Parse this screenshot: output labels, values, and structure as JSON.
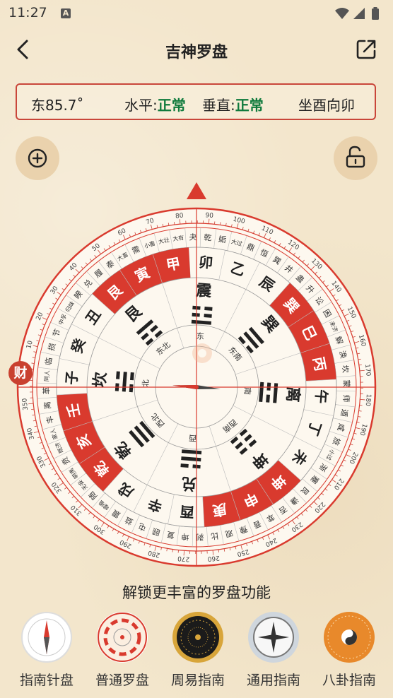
{
  "status": {
    "time": "11:27",
    "notification_icon": "A"
  },
  "header": {
    "title": "吉神罗盘",
    "back_icon": "chevron-left-icon",
    "share_icon": "share-icon"
  },
  "info": {
    "direction": "东85.7˚",
    "level_label": "水平:",
    "level_value": "正常",
    "vertical_label": "垂直:",
    "vertical_value": "正常",
    "orientation": "坐酉向卯"
  },
  "colors": {
    "accent": "#d93a2e",
    "ok": "#0f7a3c",
    "background": "#f3e6cc"
  },
  "compass": {
    "heading_degrees": 85.7,
    "degree_labels": [
      "10",
      "20",
      "30",
      "40",
      "50",
      "60",
      "70",
      "80",
      "90",
      "100",
      "110",
      "120",
      "130",
      "140",
      "150",
      "160",
      "170",
      "180",
      "190",
      "200",
      "210",
      "220",
      "230",
      "240",
      "250",
      "260",
      "270",
      "280",
      "290",
      "300",
      "310",
      "320",
      "330",
      "340",
      "350",
      "360"
    ],
    "mountains": [
      "卯",
      "乙",
      "辰",
      "巽",
      "巳",
      "丙",
      "午",
      "丁",
      "未",
      "坤",
      "申",
      "庚",
      "酉",
      "辛",
      "戌",
      "乾",
      "亥",
      "壬",
      "子",
      "癸",
      "丑",
      "艮",
      "寅",
      "甲"
    ],
    "highlighted_mountains": [
      "巽",
      "巳",
      "丙",
      "坤",
      "申",
      "庚",
      "乾",
      "亥",
      "壬",
      "艮",
      "寅",
      "甲"
    ],
    "trigrams": [
      "震",
      "巽",
      "离",
      "坤",
      "兑",
      "乾",
      "坎",
      "艮"
    ],
    "directions": [
      "东",
      "东南",
      "南",
      "西南",
      "西",
      "西北",
      "北",
      "东北"
    ],
    "hexagrams": [
      "同人",
      "临",
      "损",
      "节",
      "中孚",
      "归妹",
      "睽",
      "兑",
      "履",
      "泰",
      "大畜",
      "需",
      "小畜",
      "大壮",
      "大有",
      "夬",
      "乾",
      "姤",
      "大过",
      "鼎",
      "恒",
      "巽",
      "井",
      "蛊",
      "升",
      "讼",
      "困",
      "未济",
      "解",
      "涣",
      "坎",
      "蒙",
      "师",
      "遁",
      "咸",
      "旅",
      "小过",
      "渐",
      "蹇",
      "艮",
      "谦",
      "否",
      "萃",
      "晋",
      "豫",
      "观",
      "比",
      "剥",
      "坤",
      "复",
      "颐",
      "屯",
      "益",
      "震",
      "噬嗑",
      "随",
      "无妄",
      "明夷",
      "贲",
      "既济",
      "家人",
      "丰",
      "离",
      "革"
    ],
    "wealth_badge": "财"
  },
  "unlock_text": "解锁更丰富的罗盘功能",
  "modes": [
    {
      "label": "指南针盘",
      "icon": "compass-needle-icon"
    },
    {
      "label": "普通罗盘",
      "icon": "common-luopan-icon"
    },
    {
      "label": "周易指南",
      "icon": "zhouyi-compass-icon"
    },
    {
      "label": "通用指南",
      "icon": "general-compass-icon"
    },
    {
      "label": "八卦指南",
      "icon": "bagua-compass-icon"
    }
  ]
}
